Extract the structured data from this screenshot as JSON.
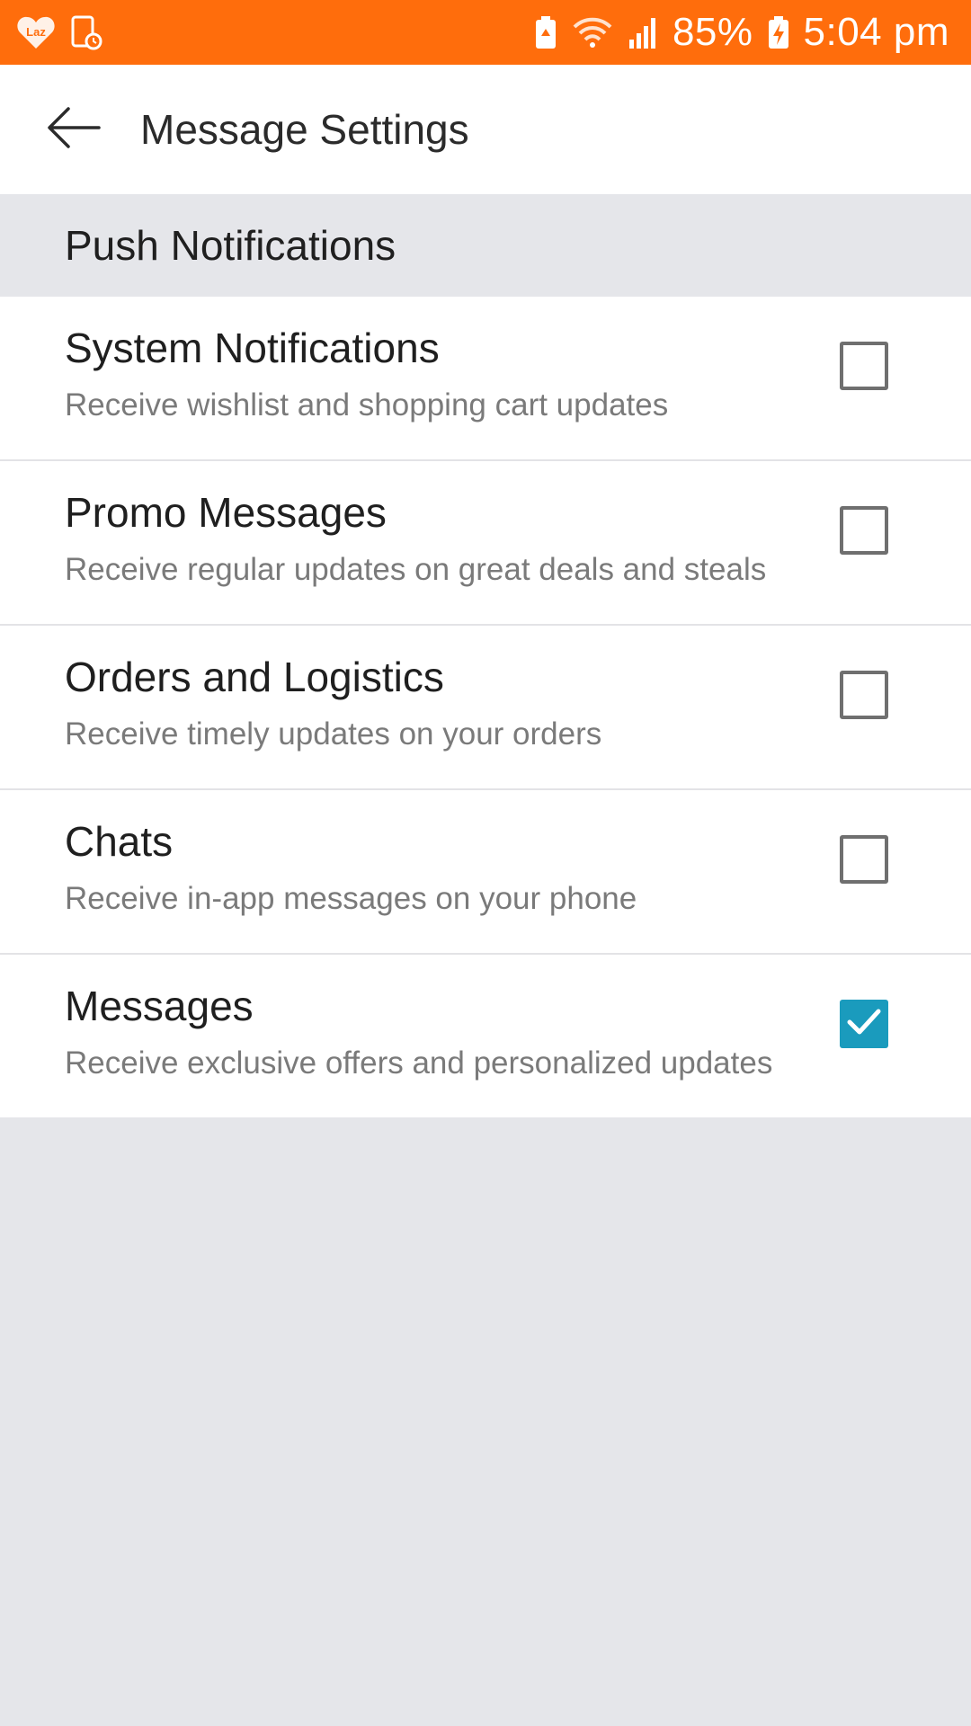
{
  "status_bar": {
    "battery": "85%",
    "time": "5:04 pm",
    "icons": [
      "laz-app-icon",
      "screen-record-icon",
      "battery-saver-icon",
      "wifi-icon",
      "signal-icon",
      "charging-battery-icon"
    ]
  },
  "header": {
    "title": "Message Settings",
    "back_icon": "arrow-left-icon"
  },
  "section": {
    "title": "Push Notifications"
  },
  "settings": [
    {
      "title": "System Notifications",
      "subtitle": "Receive wishlist and shopping cart updates",
      "checked": false
    },
    {
      "title": "Promo Messages",
      "subtitle": "Receive regular updates on great deals and steals",
      "checked": false
    },
    {
      "title": "Orders and Logistics",
      "subtitle": "Receive timely updates on your orders",
      "checked": false
    },
    {
      "title": "Chats",
      "subtitle": "Receive in-app messages on your phone",
      "checked": false
    },
    {
      "title": "Messages",
      "subtitle": "Receive exclusive offers and personalized updates",
      "checked": true
    }
  ],
  "colors": {
    "status_bar": "#ff6d0c",
    "checkbox_checked": "#1a9bbd",
    "background": "#e5e6ea"
  }
}
